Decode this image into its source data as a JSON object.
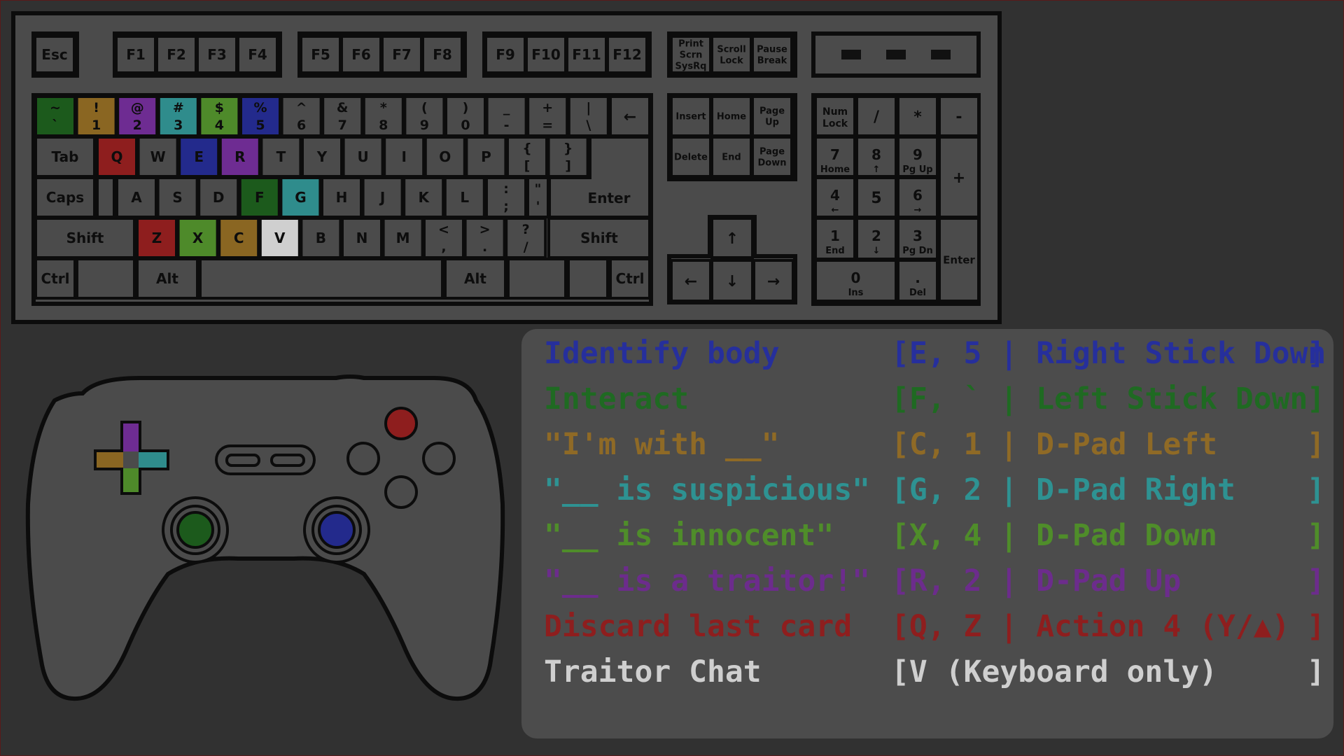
{
  "colors": {
    "background": "#313131",
    "panel": "#4c4c4c",
    "key": "#4b4b4b",
    "outline": "#0c0c0c",
    "dark_green": "#1c5a1c",
    "orange": "#8a6622",
    "purple": "#6e2c92",
    "teal": "#2f8c8c",
    "light_green": "#4e8a2a",
    "blue": "#232a8c",
    "red": "#8e1e1e",
    "white": "#cfcfcf"
  },
  "keyboard": {
    "function_row": [
      "Esc",
      "F1",
      "F2",
      "F3",
      "F4",
      "F5",
      "F6",
      "F7",
      "F8",
      "F9",
      "F10",
      "F11",
      "F12"
    ],
    "system_keys": [
      [
        "Print",
        "Scrn",
        "SysRq"
      ],
      [
        "Scroll",
        "Lock"
      ],
      [
        "Pause",
        "Break"
      ]
    ],
    "number_row": [
      {
        "top": "~",
        "bottom": "`",
        "color": "dark_green"
      },
      {
        "top": "!",
        "bottom": "1",
        "color": "orange"
      },
      {
        "top": "@",
        "bottom": "2",
        "color": "purple"
      },
      {
        "top": "#",
        "bottom": "3",
        "color": "teal"
      },
      {
        "top": "$",
        "bottom": "4",
        "color": "light_green"
      },
      {
        "top": "%",
        "bottom": "5",
        "color": "blue"
      },
      {
        "top": "^",
        "bottom": "6",
        "color": ""
      },
      {
        "top": "&",
        "bottom": "7",
        "color": ""
      },
      {
        "top": "*",
        "bottom": "8",
        "color": ""
      },
      {
        "top": "(",
        "bottom": "9",
        "color": ""
      },
      {
        "top": ")",
        "bottom": "0",
        "color": ""
      },
      {
        "top": "_",
        "bottom": "-",
        "color": ""
      },
      {
        "top": "+",
        "bottom": "=",
        "color": ""
      },
      {
        "top": "|",
        "bottom": "\\",
        "color": ""
      }
    ],
    "backspace": "←",
    "tab": "Tab",
    "row_q": [
      {
        "label": "Q",
        "color": "red"
      },
      {
        "label": "W",
        "color": ""
      },
      {
        "label": "E",
        "color": "blue"
      },
      {
        "label": "R",
        "color": "purple"
      },
      {
        "label": "T",
        "color": ""
      },
      {
        "label": "Y",
        "color": ""
      },
      {
        "label": "U",
        "color": ""
      },
      {
        "label": "I",
        "color": ""
      },
      {
        "label": "O",
        "color": ""
      },
      {
        "label": "P",
        "color": ""
      }
    ],
    "brackets": [
      {
        "top": "{",
        "bottom": "["
      },
      {
        "top": "}",
        "bottom": "]"
      }
    ],
    "caps": "Caps",
    "row_a": [
      {
        "label": "A",
        "color": ""
      },
      {
        "label": "S",
        "color": ""
      },
      {
        "label": "D",
        "color": ""
      },
      {
        "label": "F",
        "color": "dark_green"
      },
      {
        "label": "G",
        "color": "teal"
      },
      {
        "label": "H",
        "color": ""
      },
      {
        "label": "J",
        "color": ""
      },
      {
        "label": "K",
        "color": ""
      },
      {
        "label": "L",
        "color": ""
      }
    ],
    "semicolon": {
      "top": ":",
      "bottom": ";"
    },
    "quote": {
      "top": "\"",
      "bottom": "'"
    },
    "enter": "Enter",
    "shift": "Shift",
    "row_z": [
      {
        "label": "Z",
        "color": "red"
      },
      {
        "label": "X",
        "color": "light_green"
      },
      {
        "label": "C",
        "color": "orange"
      },
      {
        "label": "V",
        "color": "white"
      },
      {
        "label": "B",
        "color": ""
      },
      {
        "label": "N",
        "color": ""
      },
      {
        "label": "M",
        "color": ""
      }
    ],
    "punct_z": [
      {
        "top": "<",
        "bottom": ","
      },
      {
        "top": ">",
        "bottom": "."
      },
      {
        "top": "?",
        "bottom": "/"
      }
    ],
    "ctrl": "Ctrl",
    "alt": "Alt",
    "nav_top": [
      [
        "Insert"
      ],
      [
        "Home"
      ],
      [
        "Page",
        "Up"
      ]
    ],
    "nav_bottom": [
      [
        "Delete"
      ],
      [
        "End"
      ],
      [
        "Page",
        "Down"
      ]
    ],
    "arrows": {
      "up": "↑",
      "left": "←",
      "down": "↓",
      "right": "→"
    },
    "numpad": [
      {
        "main": "Num",
        "sub": "Lock",
        "style": "two-line"
      },
      {
        "main": "/",
        "sub": ""
      },
      {
        "main": "*",
        "sub": ""
      },
      {
        "main": "-",
        "sub": ""
      },
      {
        "main": "7",
        "sub": "Home"
      },
      {
        "main": "8",
        "sub": "↑"
      },
      {
        "main": "9",
        "sub": "Pg Up"
      },
      {
        "main": "+",
        "sub": ""
      },
      {
        "main": "4",
        "sub": "←"
      },
      {
        "main": "5",
        "sub": ""
      },
      {
        "main": "6",
        "sub": "→"
      },
      {
        "main": "1",
        "sub": "End"
      },
      {
        "main": "2",
        "sub": "↓"
      },
      {
        "main": "3",
        "sub": "Pg Dn"
      },
      {
        "main": "Enter",
        "sub": ""
      },
      {
        "main": "0",
        "sub": "Ins"
      },
      {
        "main": ".",
        "sub": "Del"
      }
    ]
  },
  "controller": {
    "dpad": {
      "up": "purple",
      "left": "orange",
      "right": "teal",
      "down": "light_green"
    },
    "left_stick": "dark_green",
    "right_stick": "blue",
    "top_face_button": "red"
  },
  "bindings": [
    {
      "label": "Identify body",
      "keys": "[E, 5 | Right Stick Down",
      "close": "]",
      "color": "#262f9c"
    },
    {
      "label": "Interact",
      "keys": "[F, ` | Left Stick Down",
      "close": "]",
      "color": "#1f6a22"
    },
    {
      "label": "\"I'm with __\"",
      "keys": "[C, 1 | D-Pad Left",
      "close": "]",
      "color": "#8f6a26"
    },
    {
      "label": "\"__ is suspicious\"",
      "keys": "[G, 2 | D-Pad Right",
      "close": "]",
      "color": "#2e9292"
    },
    {
      "label": "\"__ is innocent\"",
      "keys": "[X, 4 | D-Pad Down",
      "close": "]",
      "color": "#4f8d2a"
    },
    {
      "label": "\"__ is a traitor!\"",
      "keys": "[R, 2 | D-Pad Up",
      "close": "]",
      "color": "#6c2c8c"
    },
    {
      "label": "Discard last card",
      "keys": "[Q, Z | Action 4 (Y/▲)",
      "close": "]",
      "color": "#8e1e1e"
    },
    {
      "label": "Traitor Chat",
      "keys": "[V (Keyboard only)",
      "close": "]",
      "color": "#cfcfcf"
    }
  ]
}
